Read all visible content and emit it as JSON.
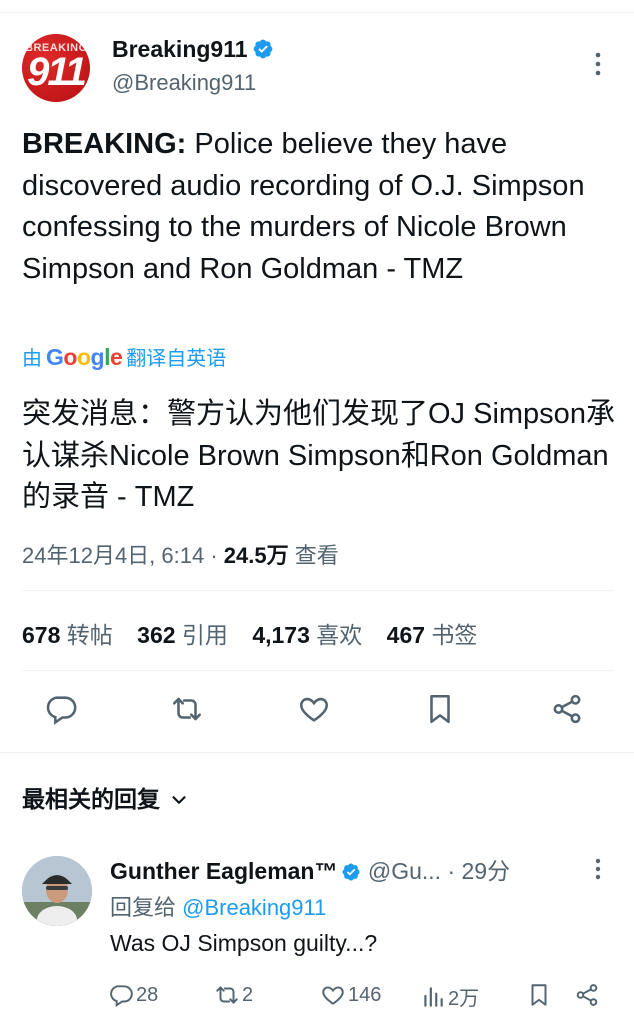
{
  "tweet": {
    "author": {
      "name": "Breaking911",
      "handle": "@Breaking911",
      "avatar_text_top": "BREAKING",
      "avatar_text_main": "911"
    },
    "text_bold": "BREAKING:",
    "text_rest": " Police believe they have discovered audio recording of O.J. Simpson confessing to the murders of Nicole Brown Simpson and Ron Goldman - TMZ",
    "translation": {
      "prefix": "由",
      "provider": "Google",
      "suffix": "翻译自英语",
      "text": "突发消息：警方认为他们发现了OJ Simpson承认谋杀Nicole Brown Simpson和Ron Goldman的录音 - TMZ"
    },
    "timestamp": "24年12月4日, 6:14",
    "views_count": "24.5万",
    "views_label": "查看"
  },
  "stats": [
    {
      "count": "678",
      "label": "转帖"
    },
    {
      "count": "362",
      "label": "引用"
    },
    {
      "count": "4,173",
      "label": "喜欢"
    },
    {
      "count": "467",
      "label": "书签"
    }
  ],
  "replies_header": "最相关的回复",
  "reply": {
    "name": "Gunther Eagleman™",
    "handle": "@Gu...",
    "time": "· 29分",
    "replying_prefix": "回复给 ",
    "replying_to": "@Breaking911",
    "text": "Was OJ Simpson guilty...?",
    "actions": {
      "replies": "28",
      "reposts": "2",
      "likes": "146",
      "views": "2万"
    }
  },
  "colors": {
    "accent": "#1d9bf0",
    "muted": "#536471",
    "text": "#0f1419"
  }
}
